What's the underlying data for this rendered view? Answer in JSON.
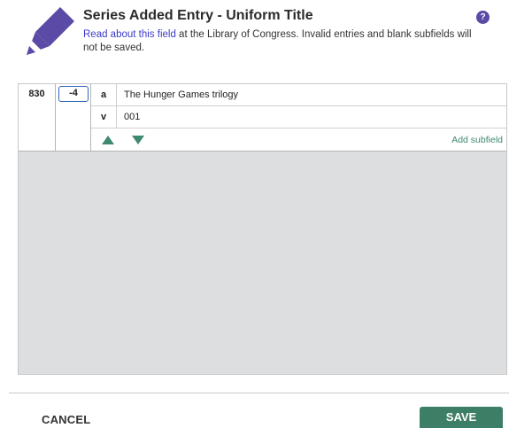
{
  "header": {
    "title": "Series Added Entry - Uniform Title",
    "link_text": "Read about this field",
    "description": " at the Library of Congress. Invalid entries and blank subfields will not be saved.",
    "help_glyph": "?",
    "icon": "pencil-icon",
    "accent_color": "#5b4aa6"
  },
  "field": {
    "tag": "830",
    "indicator": "-4",
    "subfields": [
      {
        "code": "a",
        "value": "The Hunger Games trilogy"
      },
      {
        "code": "v",
        "value": "001"
      }
    ],
    "move_up_icon": "arrow-up-icon",
    "move_down_icon": "arrow-down-icon",
    "add_subfield_label": "Add subfield",
    "control_color": "#3d8a6e"
  },
  "footer": {
    "cancel_label": "CANCEL",
    "save_label": "SAVE",
    "save_color": "#3d7e66"
  }
}
